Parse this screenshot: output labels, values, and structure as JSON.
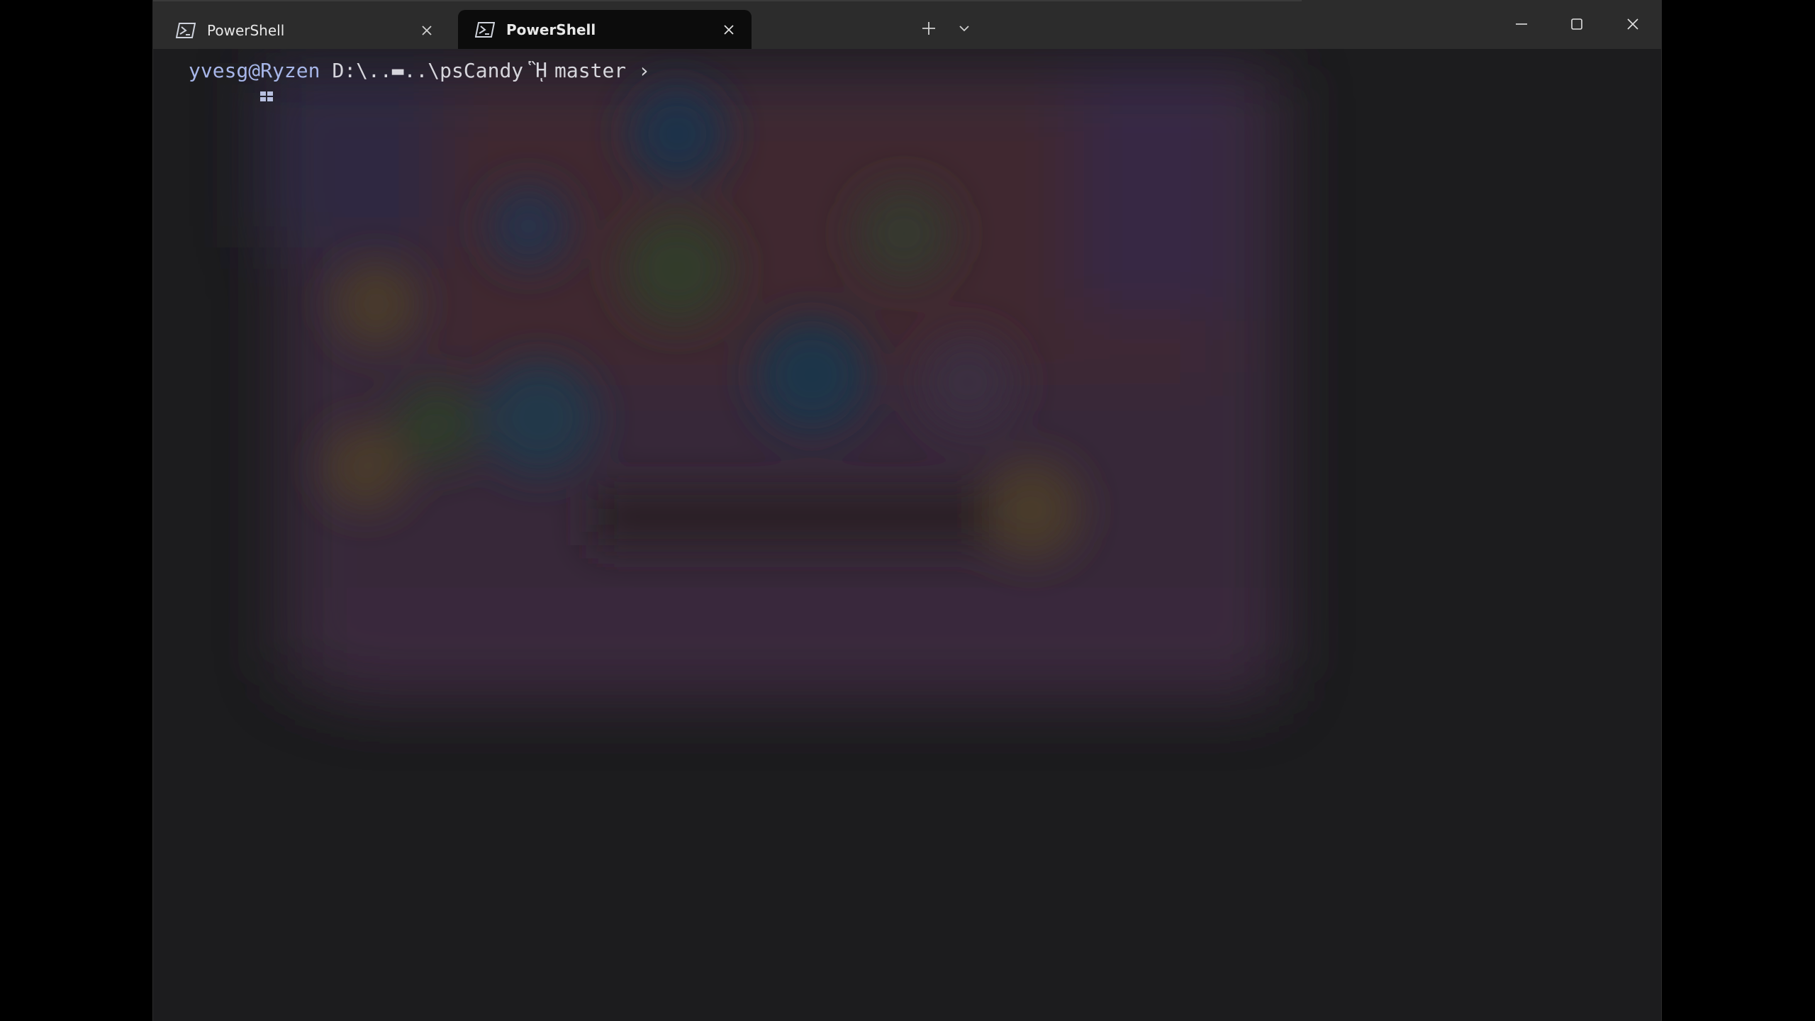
{
  "window": {
    "tabs": [
      {
        "label": "PowerShell",
        "active": false,
        "icon": "powershell-icon"
      },
      {
        "label": "PowerShell",
        "active": true,
        "icon": "powershell-icon"
      }
    ],
    "new_tab_icon": "plus-icon",
    "dropdown_icon": "chevron-down-icon",
    "controls": {
      "minimize": "minimize-icon",
      "maximize": "maximize-icon",
      "close": "close-icon"
    }
  },
  "terminal": {
    "prompt": {
      "user": "yvesg@Ryzen",
      "path": "D:\\..▬..\\psCandy",
      "branch_icon": "ᾛ",
      "branch": "master",
      "arrow": "›"
    }
  },
  "colors": {
    "titlebar": "#2c2c2c",
    "active_tab": "#0c0c0c",
    "terminal_bg": "#1c1c1e",
    "user_text": "#a7b6e8",
    "text": "#d6d6dc"
  }
}
